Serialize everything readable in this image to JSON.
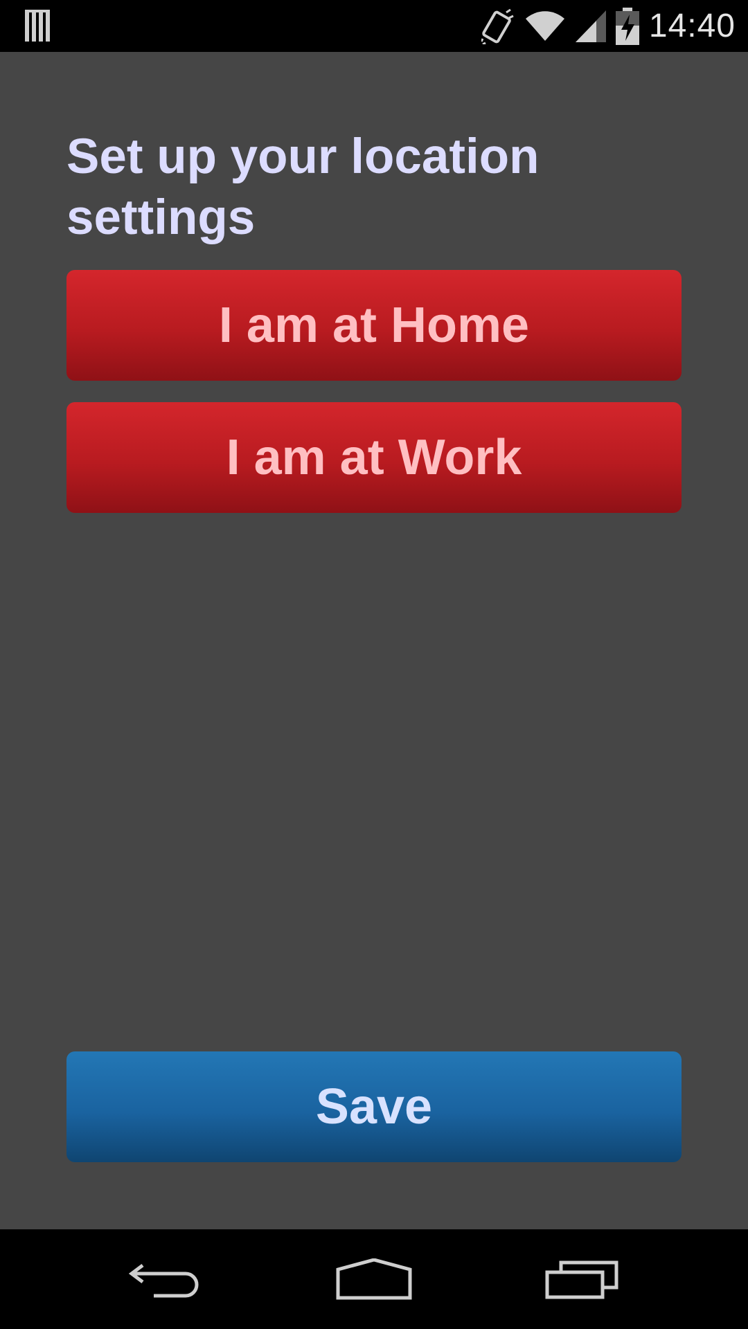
{
  "status_bar": {
    "time": "14:40",
    "icons": [
      "notification-bars-icon",
      "vibrate-icon",
      "wifi-icon",
      "cell-signal-icon",
      "battery-charging-icon"
    ]
  },
  "page": {
    "title": "Set up your location settings"
  },
  "buttons": {
    "home_label": "I am at Home",
    "work_label": "I am at Work",
    "save_label": "Save"
  },
  "colors": {
    "background": "#464646",
    "title_text": "#dcdcff",
    "location_button": "#c41f24",
    "location_button_text": "#ffbfc2",
    "save_button": "#1a63a0",
    "save_button_text": "#d8e2ff"
  },
  "nav_bar": {
    "icons": [
      "back-icon",
      "home-icon",
      "recent-apps-icon"
    ]
  }
}
